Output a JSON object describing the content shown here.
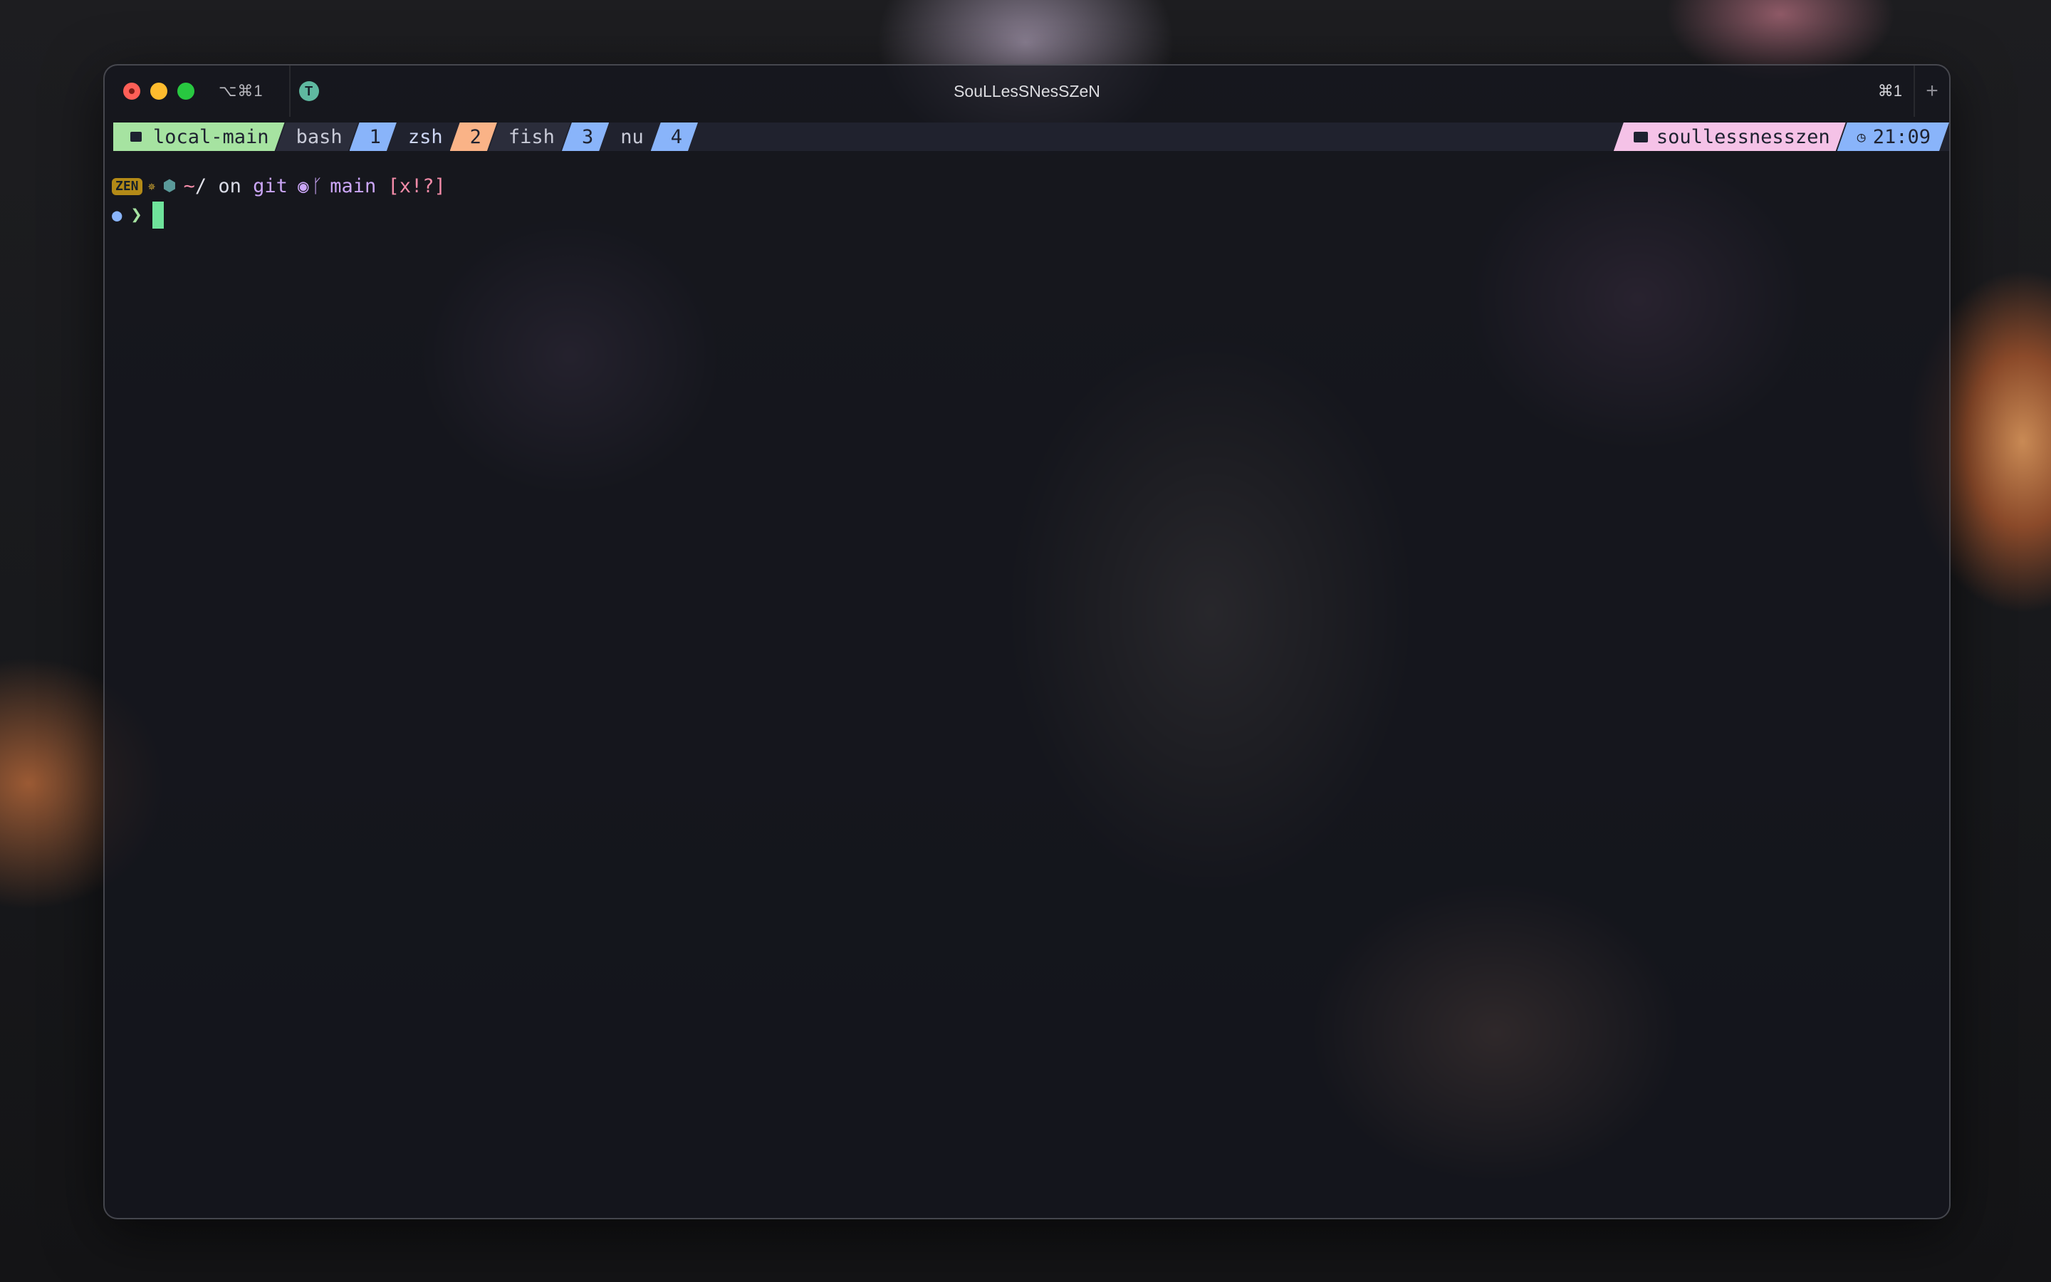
{
  "window": {
    "title": "SouLLesSNesSZeN",
    "tab_shortcut_left": "⌥⌘1",
    "tab_icon_letter": "T",
    "tab_shortcut_right": "⌘1",
    "new_tab_label": "+"
  },
  "statusbar": {
    "session": "local-main",
    "windows": [
      {
        "name": "bash",
        "index": "1"
      },
      {
        "name": "zsh",
        "index": "2"
      },
      {
        "name": "fish",
        "index": "3"
      },
      {
        "name": "nu",
        "index": "4"
      }
    ],
    "host": "soullessnesszen",
    "time": "21:09"
  },
  "prompt": {
    "badge": "ZEN",
    "dir": "~",
    "dir_sep": "/",
    "on": "on",
    "git": "git",
    "branch": "main",
    "status": "[x!?]",
    "arrow": "❯"
  },
  "icons": {
    "session": "terminal-icon",
    "host": "folder-icon",
    "time": "clock-icon",
    "github": "github-icon",
    "branch": "branch-icon",
    "os": "apple-icon"
  },
  "colors": {
    "session_bg": "#a6e3a1",
    "index_blue": "#89b4fa",
    "index_orange": "#fab387",
    "host_bg": "#f5c2e7",
    "branch": "#cba6f7",
    "git_status": "#f38ba8",
    "cursor": "#6fe39b"
  }
}
